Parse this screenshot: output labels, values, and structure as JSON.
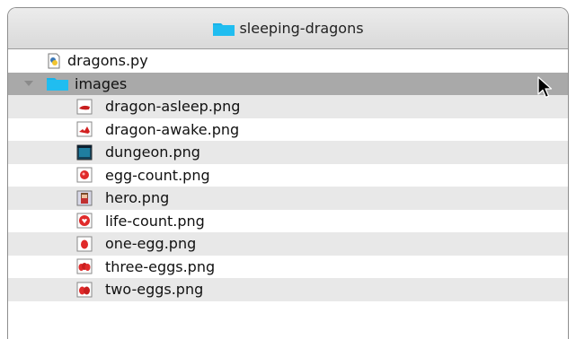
{
  "window": {
    "title": "sleeping-dragons",
    "title_icon": "folder-icon"
  },
  "files": [
    {
      "name": "dragons.py",
      "icon": "python-file-icon",
      "type": "file"
    },
    {
      "name": "images",
      "icon": "folder-icon",
      "type": "folder",
      "expanded": true,
      "selected": true
    },
    {
      "name": "dragon-asleep.png",
      "icon": "dragon-asleep-thumbnail-icon",
      "type": "image"
    },
    {
      "name": "dragon-awake.png",
      "icon": "dragon-awake-thumbnail-icon",
      "type": "image"
    },
    {
      "name": "dungeon.png",
      "icon": "dungeon-thumbnail-icon",
      "type": "image"
    },
    {
      "name": "egg-count.png",
      "icon": "egg-count-thumbnail-icon",
      "type": "image"
    },
    {
      "name": "hero.png",
      "icon": "hero-thumbnail-icon",
      "type": "image"
    },
    {
      "name": "life-count.png",
      "icon": "life-count-thumbnail-icon",
      "type": "image"
    },
    {
      "name": "one-egg.png",
      "icon": "one-egg-thumbnail-icon",
      "type": "image"
    },
    {
      "name": "three-eggs.png",
      "icon": "three-eggs-thumbnail-icon",
      "type": "image"
    },
    {
      "name": "two-eggs.png",
      "icon": "two-eggs-thumbnail-icon",
      "type": "image"
    }
  ],
  "colors": {
    "folder": "#1ab2e8",
    "selection": "#a9a9a9",
    "stripe": "#e8e8e8"
  }
}
